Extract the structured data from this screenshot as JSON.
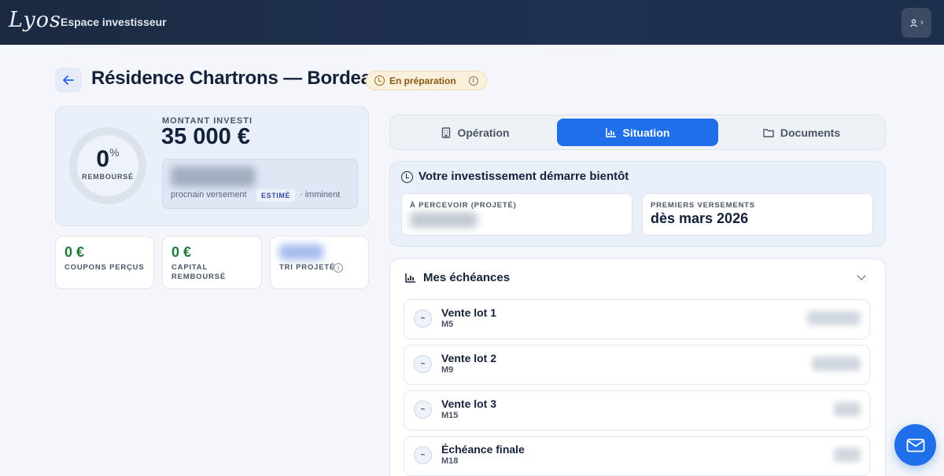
{
  "header": {
    "logo_text": "Lyos",
    "title": "Espace investisseur",
    "user_menu": "›"
  },
  "page": {
    "back_icon": "arrow-left-icon",
    "title": "Résidence Chartrons — Bordeaux",
    "status": "En préparation"
  },
  "investment": {
    "repaid_percent": "0",
    "percent_sign": "%",
    "repaid_label": "REMBOURSÉ",
    "amount_label": "MONTANT INVESTI",
    "amount_value": "35 000 €",
    "next_payment_label": "procnain versement",
    "estimate_tag": "ESTIMÉ",
    "next_payment_status": "· imminent"
  },
  "stats": [
    {
      "value": "0 €",
      "label": "COUPONS PERÇUS"
    },
    {
      "value": "0 €",
      "label": "CAPITAL REMBOURSÉ"
    },
    {
      "value": "",
      "label": "TRI PROJETÉ"
    }
  ],
  "tabs": [
    {
      "label": "Opération",
      "icon": "building-icon",
      "active": false
    },
    {
      "label": "Situation",
      "icon": "chart-icon",
      "active": true
    },
    {
      "label": "Documents",
      "icon": "folder-icon",
      "active": false
    }
  ],
  "start_card": {
    "title": "Votre investissement démarre bientôt",
    "to_receive_label": "À PERCEVOIR (PROJETÉ)",
    "first_payments_label": "PREMIERS VERSEMENTS",
    "first_payments_value": "dès mars 2026"
  },
  "schedule": {
    "title": "Mes échéances",
    "items": [
      {
        "title": "Vente lot 1",
        "sub": "M5",
        "icon": "~"
      },
      {
        "title": "Vente lot 2",
        "sub": "M9",
        "icon": "~"
      },
      {
        "title": "Vente lot 3",
        "sub": "M15",
        "icon": "~"
      },
      {
        "title": "Échéance finale",
        "sub": "M18",
        "icon": "~"
      }
    ]
  },
  "colors": {
    "header_bg": "#1b2a41",
    "accent": "#1f6feb",
    "positive": "#1e7a3a",
    "status_bg": "#fbf0dc"
  }
}
